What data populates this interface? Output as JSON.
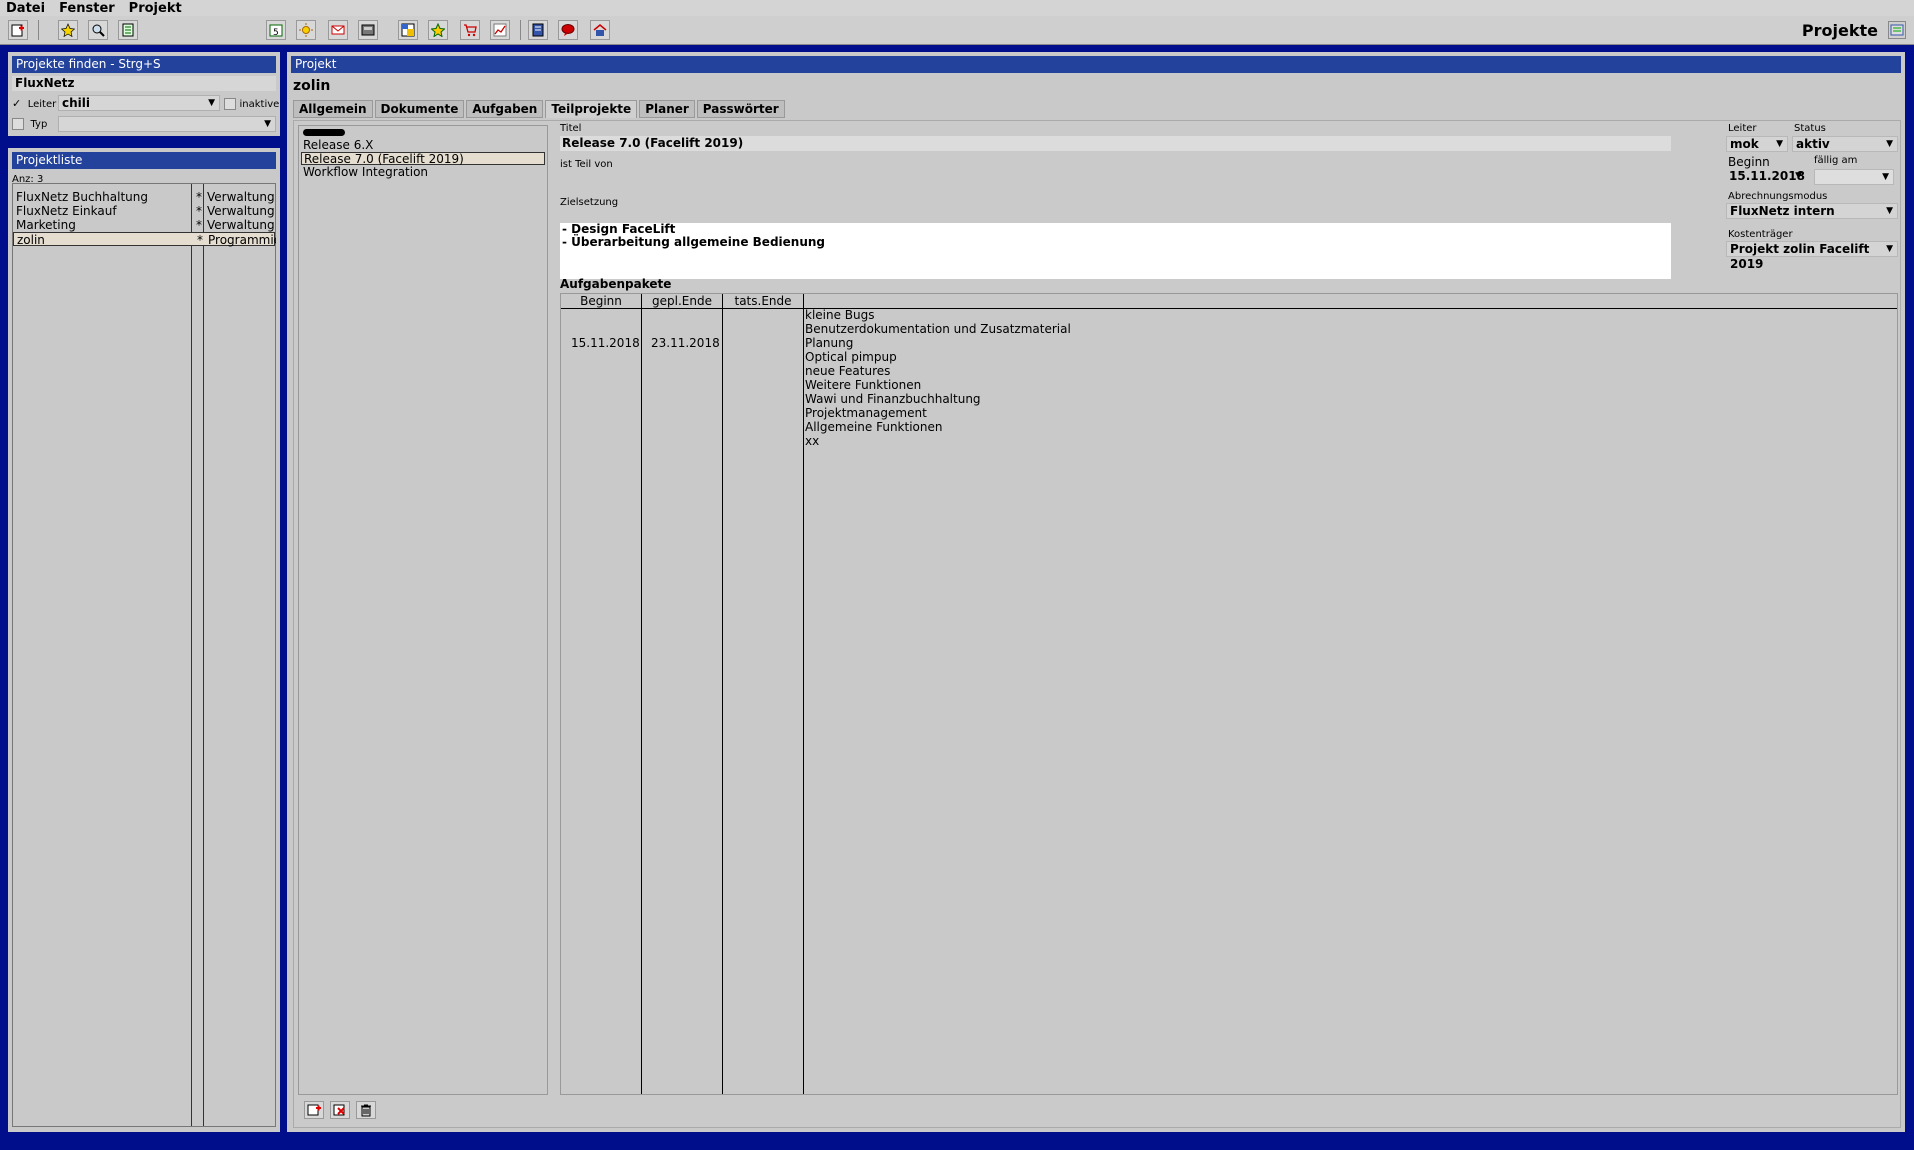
{
  "menu": {
    "items": [
      {
        "label": "Datei"
      },
      {
        "label": "Fenster"
      },
      {
        "label": "Projekt"
      }
    ]
  },
  "toolbar": {
    "app_title": "Projekte",
    "icons": [
      "new-icon",
      "star-icon",
      "search-icon",
      "report-icon",
      "calendar-icon",
      "sun-icon",
      "mail-icon",
      "archive-icon",
      "window-icon",
      "star-add-icon",
      "cart-icon",
      "chart-icon",
      "book-icon",
      "chat-icon",
      "home-icon"
    ]
  },
  "search": {
    "title": "Projekte finden - Strg+S",
    "query": "FluxNetz",
    "leiter_label": "Leiter",
    "leiter_value": "chili",
    "inaktive_label": "inaktive",
    "typ_label": "Typ",
    "typ_value": ""
  },
  "projectlist": {
    "title": "Projektliste",
    "count": "Anz: 3",
    "rows": [
      {
        "name": "FluxNetz Buchhaltung",
        "flag": "*",
        "type": "Verwaltung"
      },
      {
        "name": "FluxNetz Einkauf",
        "flag": "*",
        "type": "Verwaltung"
      },
      {
        "name": "Marketing",
        "flag": "*",
        "type": "Verwaltung"
      },
      {
        "name": "zolin",
        "flag": "*",
        "type": "Programmieru"
      }
    ]
  },
  "project": {
    "header": "Projekt",
    "name": "zolin",
    "tabs": [
      "Allgemein",
      "Dokumente",
      "Aufgaben",
      "Teilprojekte",
      "Planer",
      "Passwörter"
    ],
    "subprojects": [
      "Release 6.X",
      "Release 7.0 (Facelift 2019)",
      "Workflow Integration"
    ],
    "detail": {
      "titel_label": "Titel",
      "titel_value": "Release 7.0 (Facelift 2019)",
      "teil_von_label": "ist Teil von",
      "teil_von_value": "",
      "ziel_label": "Zielsetzung",
      "ziel_lines": [
        "- Design FaceLift",
        "- Überarbeitung allgemeine Bedienung"
      ],
      "leiter_label": "Leiter",
      "leiter_value": "mok",
      "status_label": "Status",
      "status_value": "aktiv",
      "beginn_label": "Beginn",
      "beginn_value": "15.11.2018",
      "faellig_label": "fällig am",
      "faellig_value": "",
      "abrechnung_label": "Abrechnungsmodus",
      "abrechnung_value": "FluxNetz intern",
      "kosten_label": "Kostenträger",
      "kosten_value": "Projekt zolin Facelift 2019"
    },
    "tasks": {
      "title": "Aufgabenpakete",
      "columns": [
        "Beginn",
        "gepl.Ende",
        "tats.Ende"
      ],
      "beginn": "15.11.2018",
      "gepl_ende": "23.11.2018",
      "tats_ende": "",
      "items": [
        "kleine Bugs",
        "Benutzerdokumentation und Zusatzmaterial",
        "Planung",
        "Optical pimpup",
        "neue Features",
        "Weitere Funktionen",
        "Wawi und Finanzbuchhaltung",
        "Projektmanagement",
        "Allgemeine Funktionen",
        "xx"
      ]
    }
  }
}
